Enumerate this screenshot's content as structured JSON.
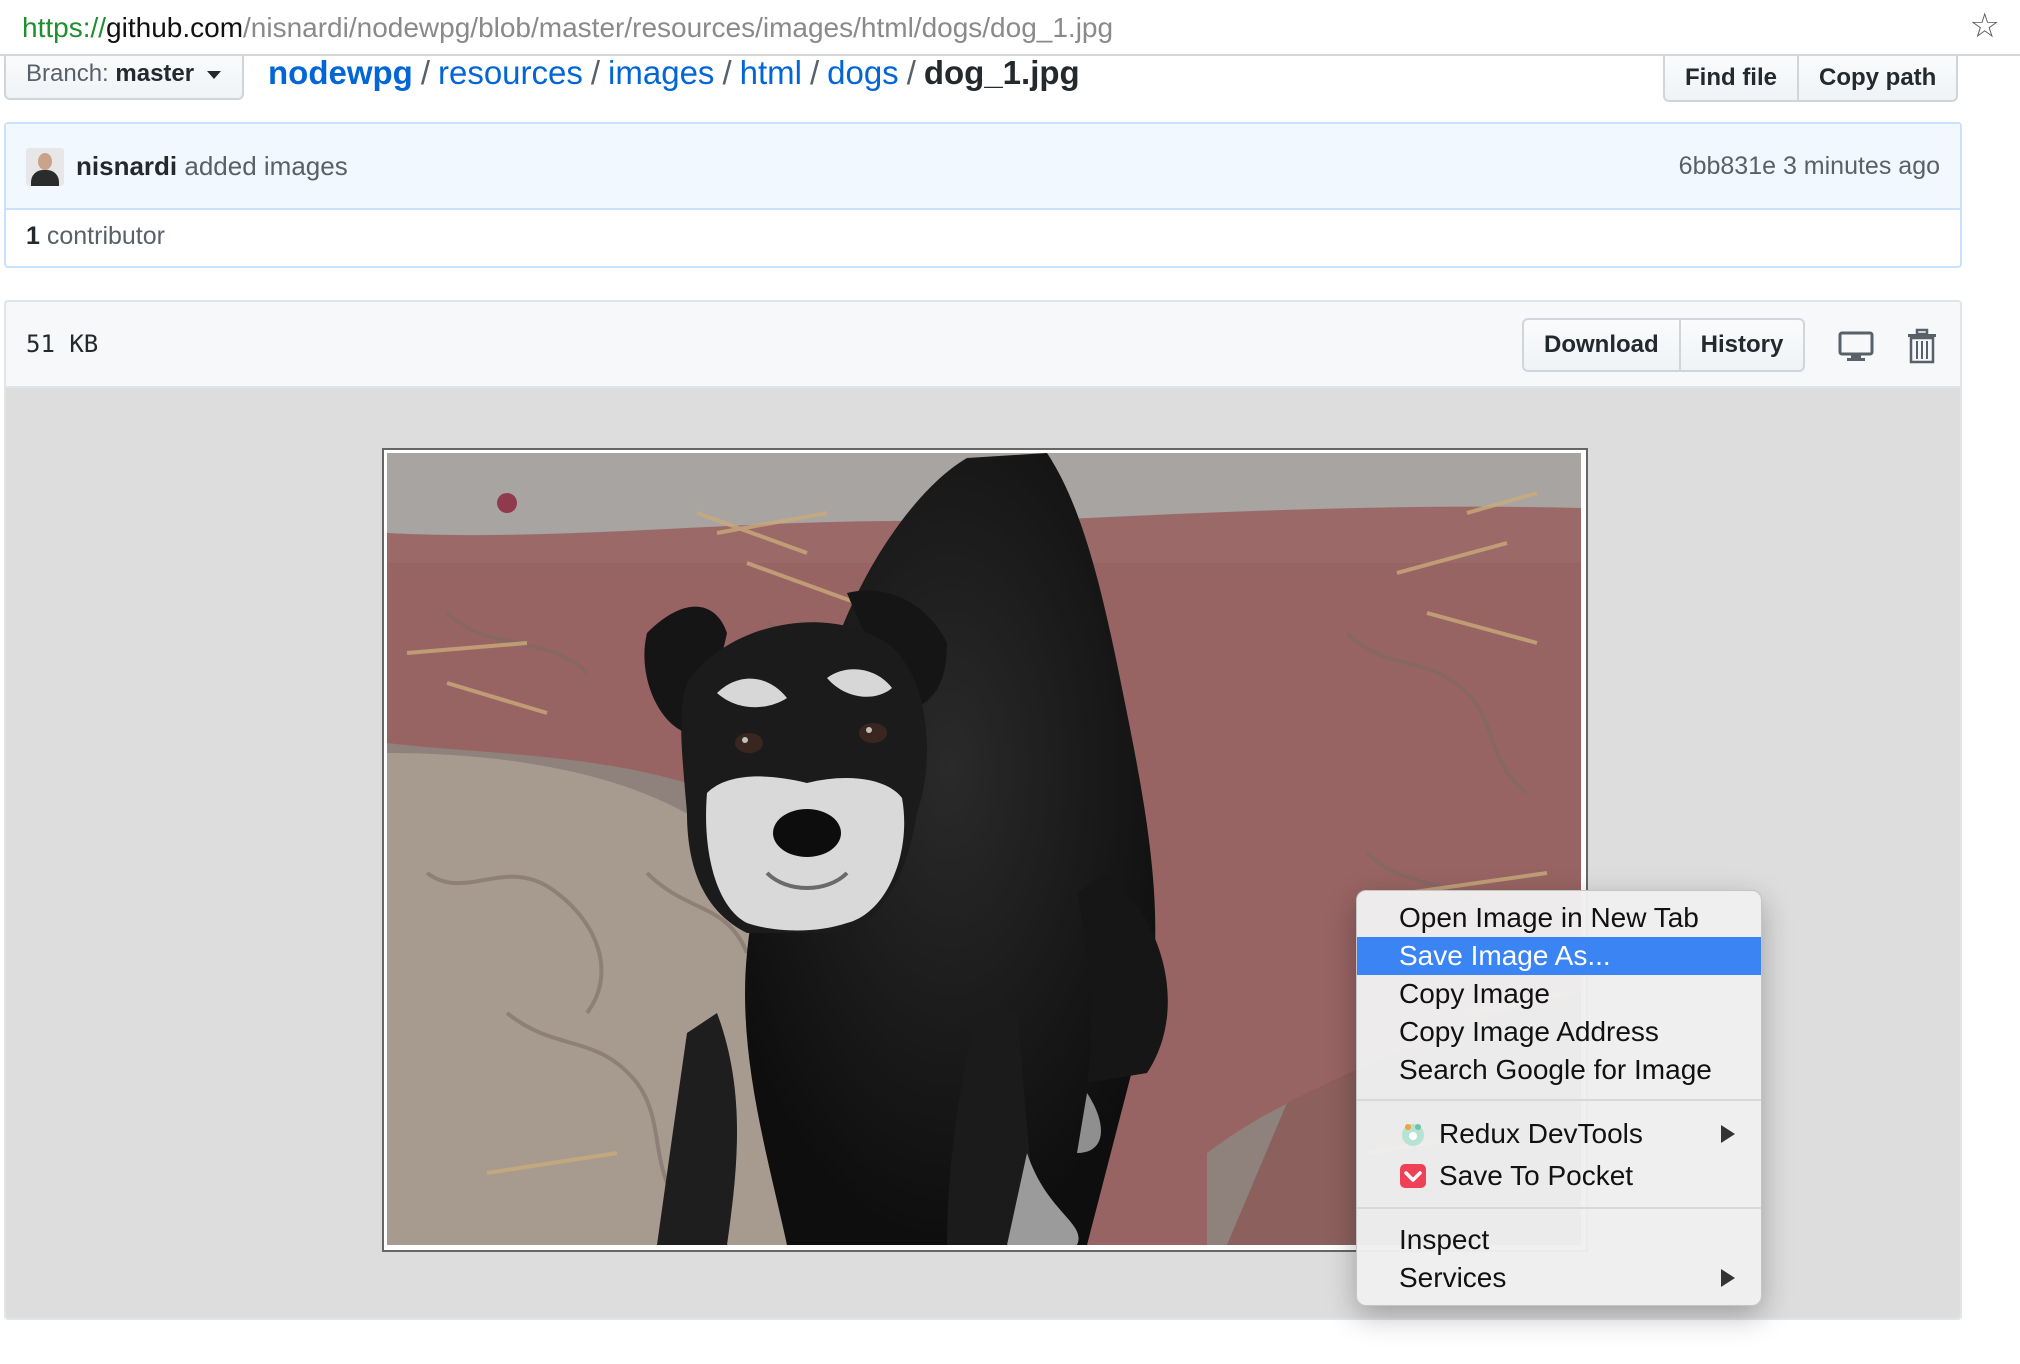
{
  "browser": {
    "url_scheme": "https://",
    "url_host": "github.com",
    "url_path": "/nisnardi/nodewpg/blob/master/resources/images/html/dogs/dog_1.jpg"
  },
  "branch": {
    "label": "Branch:",
    "value": "master"
  },
  "breadcrumb": {
    "repo": "nodewpg",
    "parts": [
      "resources",
      "images",
      "html",
      "dogs"
    ],
    "separator": "/",
    "filename": "dog_1.jpg"
  },
  "file_nav": {
    "find_file": "Find file",
    "copy_path": "Copy path"
  },
  "commit": {
    "author": "nisnardi",
    "message": "added images",
    "sha": "6bb831e",
    "time": "3 minutes ago",
    "contributors_count": "1",
    "contributors_label": "contributor"
  },
  "file": {
    "size": "51 KB",
    "download": "Download",
    "history": "History"
  },
  "context_menu": {
    "items": [
      "Open Image in New Tab",
      "Save Image As...",
      "Copy Image",
      "Copy Image Address",
      "Search Google for Image"
    ],
    "selected_index": 1,
    "extensions": [
      "Redux DevTools",
      "Save To Pocket"
    ],
    "tools": [
      "Inspect",
      "Services"
    ]
  },
  "colors": {
    "link": "#0366d6",
    "menu_highlight": "#3a84f3",
    "commit_bg": "#f1f8ff"
  },
  "icons": [
    "star-icon",
    "chevron-down-icon",
    "desktop-icon",
    "trash-icon",
    "redux-devtools-icon",
    "pocket-icon",
    "submenu-arrow-icon"
  ]
}
